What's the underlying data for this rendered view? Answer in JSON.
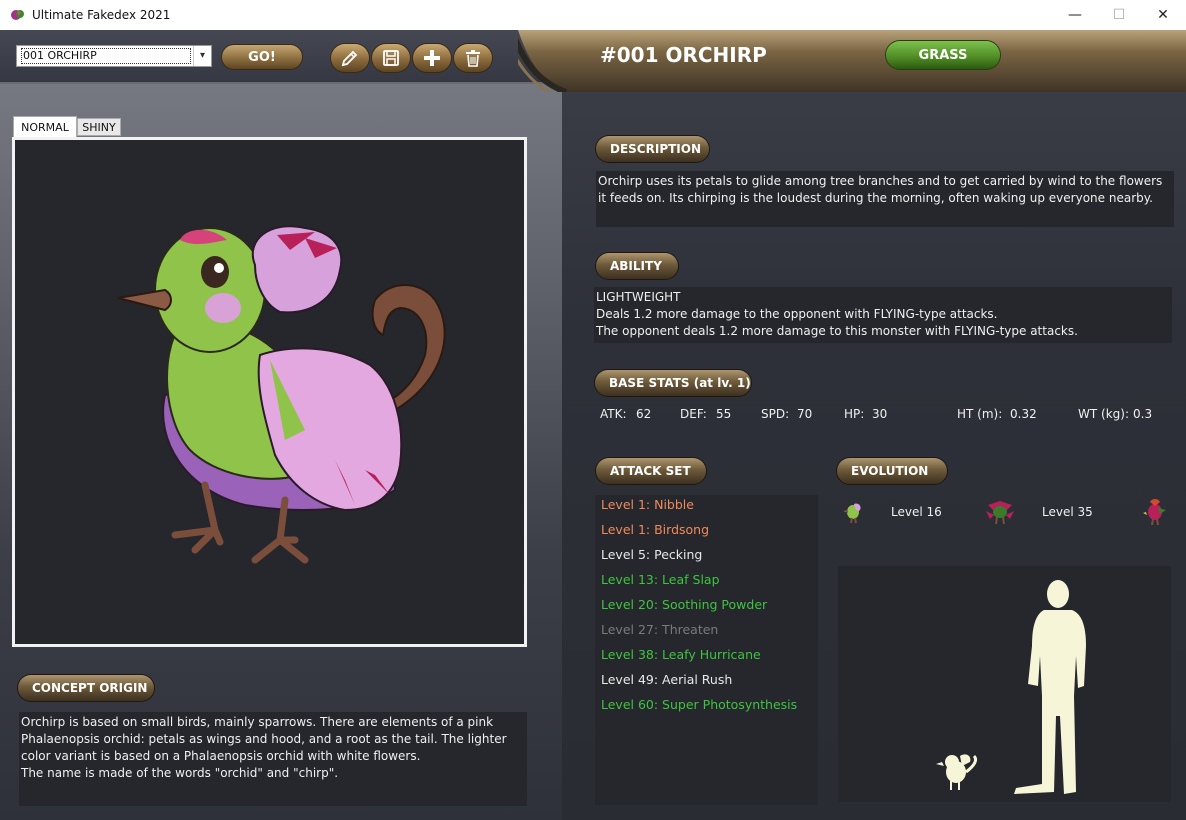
{
  "window": {
    "title": "Ultimate Fakedex 2021",
    "minimize": "—",
    "maximize": "☐",
    "close": "✕"
  },
  "toolbar": {
    "selector_value": "001 ORCHIRP",
    "go_label": "GO!",
    "icons": [
      "pencil-icon",
      "save-icon",
      "plus-icon",
      "trash-icon"
    ]
  },
  "header": {
    "title": "#001 ORCHIRP",
    "type": "GRASS",
    "type_color": "#5a9a2c"
  },
  "tabs": {
    "normal": "NORMAL",
    "shiny": "SHINY"
  },
  "concept": {
    "heading": "CONCEPT ORIGIN",
    "text": "Orchirp is based on small birds, mainly sparrows. There are elements of a pink Phalaenopsis orchid: petals as wings and hood, and a root as the tail. The lighter color variant is based on a Phalaenopsis orchid with white flowers.",
    "text2": "The name is made of the words \"orchid\" and \"chirp\"."
  },
  "description": {
    "heading": "DESCRIPTION",
    "text": "Orchirp uses its petals to glide among tree branches and to get carried by wind to the flowers it feeds on. Its chirping is the loudest during the morning, often waking up everyone nearby."
  },
  "ability": {
    "heading": "ABILITY",
    "name": "LIGHTWEIGHT",
    "line1": "Deals 1.2 more damage to the opponent with FLYING-type attacks.",
    "line2": "The opponent deals 1.2 more damage to this monster with FLYING-type attacks."
  },
  "stats": {
    "heading": "BASE STATS (at lv. 1)",
    "atk_label": "ATK:",
    "atk": "62",
    "def_label": "DEF:",
    "def": "55",
    "spd_label": "SPD:",
    "spd": "70",
    "hp_label": "HP:",
    "hp": "30",
    "ht_label": "HT (m):",
    "ht": "0.32",
    "wt_label": "WT (kg):",
    "wt": "0.3"
  },
  "attacks": {
    "heading": "ATTACK SET",
    "items": [
      {
        "label": "Level 1: Nibble",
        "color": "#f08a5a"
      },
      {
        "label": "Level 1: Birdsong",
        "color": "#f08a5a"
      },
      {
        "label": "Level 5: Pecking",
        "color": "#e8e8e8"
      },
      {
        "label": "Level 13: Leaf Slap",
        "color": "#3ec43e"
      },
      {
        "label": "Level 20: Soothing Powder",
        "color": "#3ec43e"
      },
      {
        "label": "Level 27: Threaten",
        "color": "#7a7a7a"
      },
      {
        "label": "Level 38: Leafy Hurricane",
        "color": "#3ec43e"
      },
      {
        "label": "Level 49: Aerial Rush",
        "color": "#e8e8e8"
      },
      {
        "label": "Level 60: Super Photosynthesis",
        "color": "#3ec43e"
      }
    ]
  },
  "evolution": {
    "heading": "EVOLUTION",
    "level1": "Level 16",
    "level2": "Level 35"
  }
}
